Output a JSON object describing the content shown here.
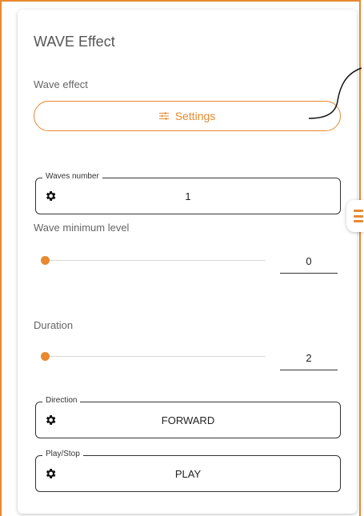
{
  "page": {
    "title": "WAVE Effect"
  },
  "wave_effect": {
    "label": "Wave effect",
    "settings_button": "Settings"
  },
  "waves_number": {
    "legend": "Waves number",
    "value": "1"
  },
  "wave_minimum_level": {
    "label": "Wave minimum level",
    "value": "0",
    "slider_level": 0
  },
  "duration": {
    "label": "Duration",
    "value": "2",
    "slider_level": 0
  },
  "direction": {
    "legend": "Direction",
    "value": "FORWARD"
  },
  "play_stop": {
    "legend": "Play/Stop",
    "value": "PLAY"
  },
  "colors": {
    "accent": "#e8892f",
    "text": "#555555"
  },
  "icons": [
    "settings-sliders-icon",
    "gear-icon",
    "menu-icon"
  ]
}
